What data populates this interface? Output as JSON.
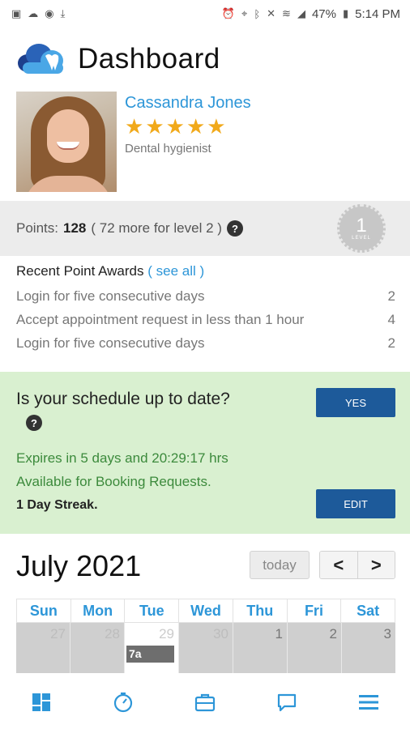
{
  "status_bar": {
    "left_icons": [
      "image-icon",
      "cloud-icon",
      "at-icon",
      "download-icon"
    ],
    "battery": "47%",
    "time": "5:14 PM"
  },
  "header": {
    "title": "Dashboard"
  },
  "profile": {
    "name": "Cassandra Jones",
    "rating": 5,
    "role": "Dental hygienist"
  },
  "points": {
    "label": "Points:",
    "value": "128",
    "next_level_text": "( 72 more for level 2 )",
    "help": "?",
    "level_number": "1",
    "level_label": "LEVEL"
  },
  "awards": {
    "title": "Recent Point Awards",
    "see_all_open": "(",
    "see_all": "see all",
    "see_all_close": ")",
    "items": [
      {
        "label": "Login for five consecutive days",
        "points": "2"
      },
      {
        "label": "Accept appointment request in less than 1 hour",
        "points": "4"
      },
      {
        "label": "Login for five consecutive days",
        "points": "2"
      }
    ]
  },
  "schedule": {
    "question": "Is your schedule up to date?",
    "help": "?",
    "yes_label": "YES",
    "expires": "Expires in 5 days and 20:29:17 hrs",
    "availability": "Available for Booking Requests.",
    "streak": "1 Day Streak.",
    "edit_label": "EDIT"
  },
  "calendar": {
    "month": "July 2021",
    "today_label": "today",
    "prev_label": "<",
    "next_label": ">",
    "weekdays": [
      "Sun",
      "Mon",
      "Tue",
      "Wed",
      "Thu",
      "Fri",
      "Sat"
    ],
    "dates": [
      "27",
      "28",
      "29",
      "30",
      "1",
      "2",
      "3"
    ],
    "event_label": "7a"
  },
  "bottom_nav": [
    "dashboard-icon",
    "clock-icon",
    "briefcase-icon",
    "chat-icon",
    "menu-icon"
  ],
  "colors": {
    "accent": "#2d96d8",
    "button": "#1d5a9a",
    "star": "#f1a91a",
    "schedule_bg": "#d9f0d0",
    "green_text": "#3c8a3c"
  }
}
